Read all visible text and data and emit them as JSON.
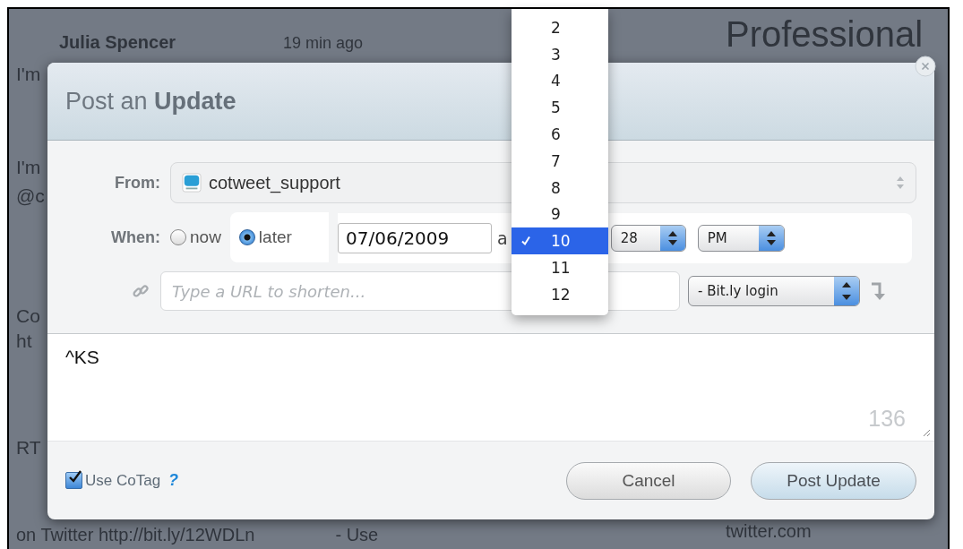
{
  "background": {
    "author": "Julia Spencer",
    "time": "19 min ago",
    "heading": "Professional",
    "fragments": [
      "I'm",
      "I'm",
      "@c",
      "Co",
      "ht",
      "RT"
    ],
    "footer_line": "on Twitter  http://bit.ly/12WDLn",
    "footer_action": "- Use",
    "footer_link": "twitter.com"
  },
  "dialog": {
    "title": "Post an **Update**",
    "from": {
      "label": "From:",
      "account": "cotweet_support"
    },
    "when": {
      "label": "When:",
      "options": [
        {
          "label": "now",
          "selected": false
        },
        {
          "label": "later",
          "selected": true
        }
      ],
      "date": "07/06/2009",
      "at": "a",
      "minute": "28",
      "ampm": "PM"
    },
    "url": {
      "placeholder": "Type a URL to shorten...",
      "shortener": "- Bit.ly login"
    },
    "message": {
      "value": "^KS",
      "count": "136"
    },
    "cotag": {
      "label": "Use CoTag",
      "checked": true,
      "help": "?"
    },
    "buttons": [
      {
        "label": "Cancel",
        "kind": "secondary"
      },
      {
        "label": "Post Update",
        "kind": "primary"
      }
    ]
  },
  "hour_menu": [
    {
      "label": "2",
      "selected": false
    },
    {
      "label": "3",
      "selected": false
    },
    {
      "label": "4",
      "selected": false
    },
    {
      "label": "5",
      "selected": false
    },
    {
      "label": "6",
      "selected": false
    },
    {
      "label": "7",
      "selected": false
    },
    {
      "label": "8",
      "selected": false
    },
    {
      "label": "9",
      "selected": false
    },
    {
      "label": "10",
      "selected": true
    },
    {
      "label": "11",
      "selected": false
    },
    {
      "label": "12",
      "selected": false
    }
  ]
}
